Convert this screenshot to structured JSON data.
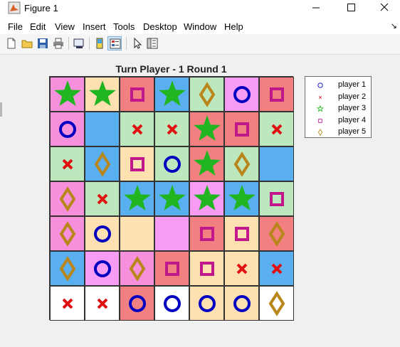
{
  "window": {
    "title": "Figure 1",
    "minimize_label": "—",
    "maximize_label": "☐",
    "close_label": "✕"
  },
  "menu": {
    "items": [
      "File",
      "Edit",
      "View",
      "Insert",
      "Tools",
      "Desktop",
      "Window",
      "Help"
    ],
    "extra": "↘"
  },
  "toolbar": {
    "buttons": [
      {
        "icon": "new-figure-icon"
      },
      {
        "icon": "open-file-icon"
      },
      {
        "icon": "save-icon"
      },
      {
        "icon": "print-icon"
      },
      {
        "icon": "link-plot-icon"
      },
      {
        "icon": "insert-colorbar-icon"
      },
      {
        "icon": "insert-legend-icon",
        "active": true
      },
      {
        "icon": "edit-plot-icon"
      },
      {
        "icon": "property-inspector-icon"
      }
    ]
  },
  "plot": {
    "title": "Turn Player - 1 Round 1",
    "colors": {
      "pink": "#f690dc",
      "tan": "#ffe0b0",
      "red": "#f28080",
      "blue": "#5aaff0",
      "green": "#bde7bd",
      "magenta": "#f69cf5",
      "white": "#ffffff"
    },
    "grid": [
      [
        [
          "pink",
          "star"
        ],
        [
          "tan",
          "star"
        ],
        [
          "red",
          "square"
        ],
        [
          "blue",
          "star"
        ],
        [
          "green",
          "diamond"
        ],
        [
          "magenta",
          "circle"
        ],
        [
          "red",
          "square"
        ]
      ],
      [
        [
          "pink",
          "circle"
        ],
        [
          "blue",
          ""
        ],
        [
          "green",
          "x"
        ],
        [
          "green",
          "x"
        ],
        [
          "red",
          "star"
        ],
        [
          "red",
          "square"
        ],
        [
          "green",
          "x"
        ]
      ],
      [
        [
          "green",
          "x"
        ],
        [
          "blue",
          "diamond"
        ],
        [
          "tan",
          "square"
        ],
        [
          "green",
          "circle"
        ],
        [
          "red",
          "star"
        ],
        [
          "green",
          "diamond"
        ],
        [
          "blue",
          ""
        ]
      ],
      [
        [
          "pink",
          "diamond"
        ],
        [
          "green",
          "x"
        ],
        [
          "blue",
          "star"
        ],
        [
          "blue",
          "star"
        ],
        [
          "magenta",
          "star"
        ],
        [
          "blue",
          "star"
        ],
        [
          "green",
          "square"
        ]
      ],
      [
        [
          "pink",
          "diamond"
        ],
        [
          "tan",
          "circle"
        ],
        [
          "tan",
          ""
        ],
        [
          "magenta",
          ""
        ],
        [
          "red",
          "square"
        ],
        [
          "tan",
          "square"
        ],
        [
          "red",
          "diamond"
        ]
      ],
      [
        [
          "blue",
          "diamond"
        ],
        [
          "magenta",
          "circle"
        ],
        [
          "pink",
          "diamond"
        ],
        [
          "red",
          "square"
        ],
        [
          "tan",
          "square"
        ],
        [
          "tan",
          "x"
        ],
        [
          "blue",
          "x"
        ]
      ],
      [
        [
          "white",
          "x"
        ],
        [
          "white",
          "x"
        ],
        [
          "red",
          "circle"
        ],
        [
          "white",
          "circle"
        ],
        [
          "tan",
          "circle"
        ],
        [
          "tan",
          "circle"
        ],
        [
          "white",
          "diamond"
        ]
      ]
    ],
    "markers": {
      "circle": {
        "color": "#0000c0"
      },
      "x": {
        "color": "#e01010"
      },
      "star": {
        "color": "#22b522"
      },
      "square": {
        "color": "#c0188c"
      },
      "diamond": {
        "color": "#b8861a"
      }
    }
  },
  "legend": {
    "entries": [
      {
        "label": "player 1",
        "marker": "circle",
        "color": "#0000c0"
      },
      {
        "label": "player 2",
        "marker": "x",
        "color": "#e01010"
      },
      {
        "label": "player 3",
        "marker": "star",
        "color": "#22b522"
      },
      {
        "label": "player 4",
        "marker": "square",
        "color": "#c0188c"
      },
      {
        "label": "player 5",
        "marker": "diamond",
        "color": "#b8861a"
      }
    ]
  }
}
